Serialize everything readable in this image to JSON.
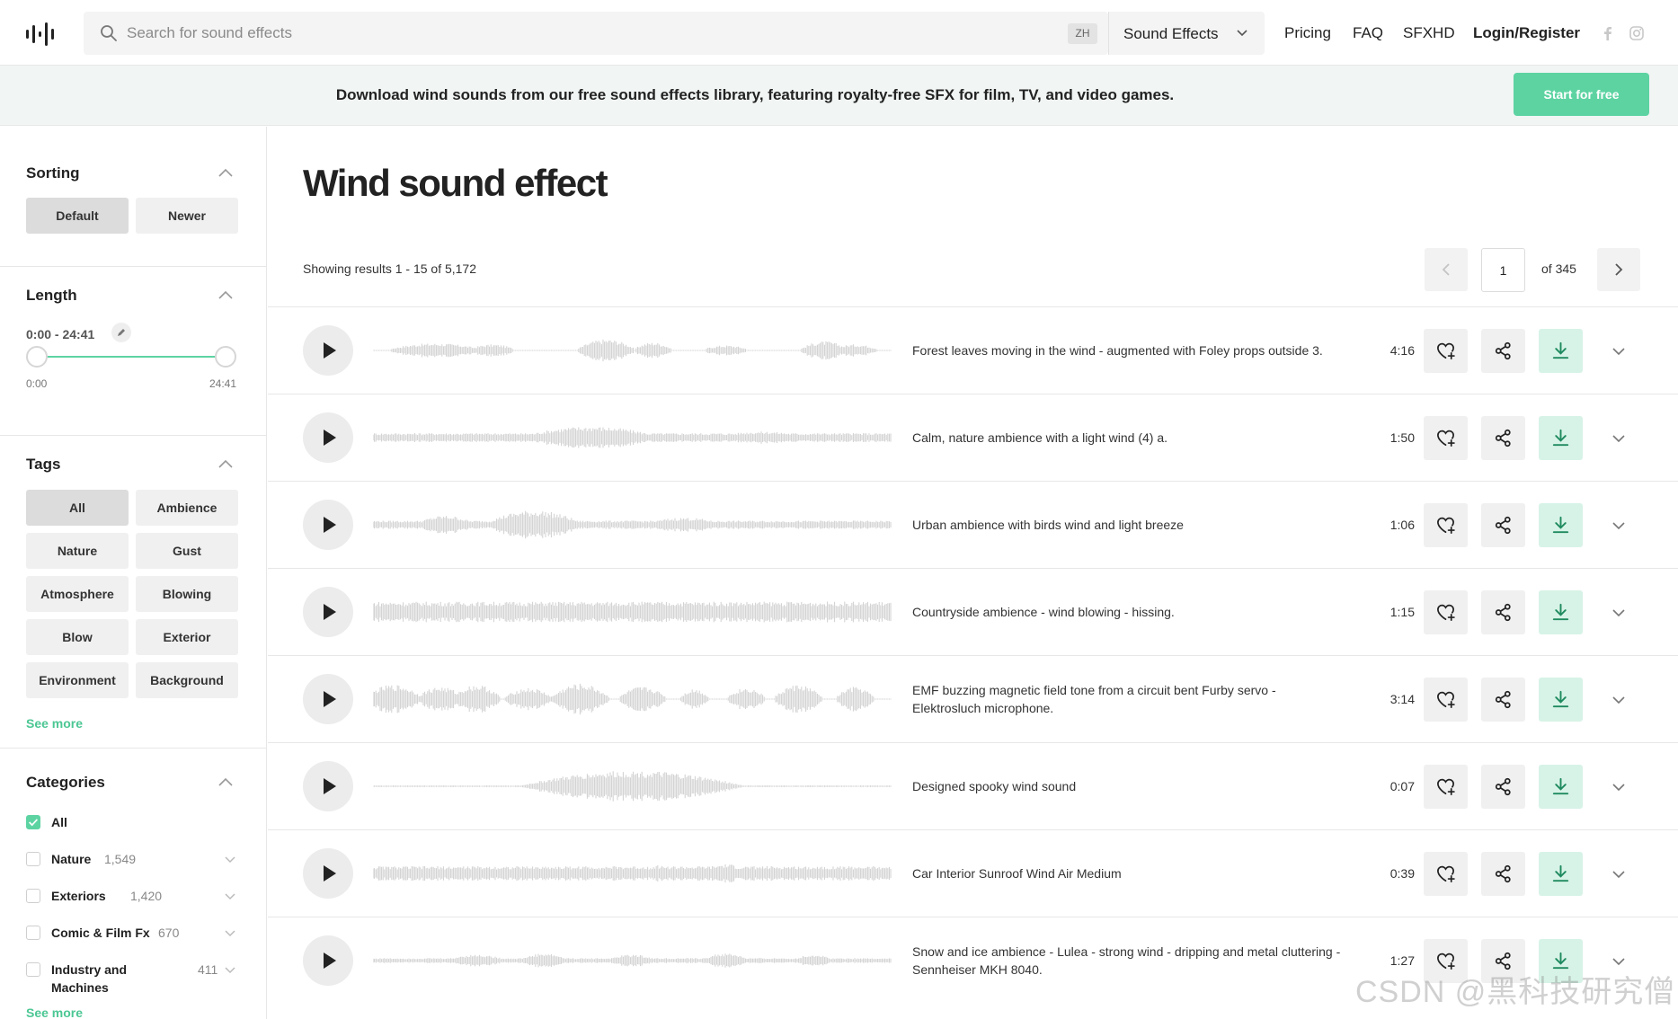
{
  "header": {
    "search": {
      "placeholder": "Search for sound effects",
      "lang_badge": "ZH"
    },
    "type_select": "Sound Effects",
    "nav": {
      "pricing": "Pricing",
      "faq": "FAQ",
      "sfxhd": "SFXHD",
      "login": "Login/Register"
    },
    "icons": [
      "logo-icon",
      "search-icon",
      "chevron-down-icon",
      "facebook-icon",
      "instagram-icon"
    ]
  },
  "banner": {
    "text": "Download wind sounds from our free sound effects library, featuring royalty-free SFX for film, TV, and video games.",
    "cta": "Start for free"
  },
  "sidebar": {
    "sorting": {
      "title": "Sorting",
      "options": [
        "Default",
        "Newer"
      ],
      "selected": "Default"
    },
    "length": {
      "title": "Length",
      "range_label": "0:00 - 24:41",
      "min_label": "0:00",
      "max_label": "24:41",
      "selected_min_fraction": 0.0,
      "selected_max_fraction": 1.0
    },
    "tags": {
      "title": "Tags",
      "items": [
        "All",
        "Ambience",
        "Nature",
        "Gust",
        "Atmosphere",
        "Blowing",
        "Blow",
        "Exterior",
        "Environment",
        "Background"
      ],
      "selected": "All",
      "see_more": "See more"
    },
    "categories": {
      "title": "Categories",
      "items": [
        {
          "name": "All",
          "count": "",
          "checked": true
        },
        {
          "name": "Nature",
          "count": "1,549",
          "checked": false
        },
        {
          "name": "Exteriors",
          "count": "1,420",
          "checked": false
        },
        {
          "name": "Comic & Film Fx",
          "count": "670",
          "checked": false
        },
        {
          "name": "Industry and Machines",
          "count": "411",
          "checked": false
        }
      ],
      "see_more": "See more"
    }
  },
  "main": {
    "title": "Wind sound effect",
    "results": "Showing results 1 - 15 of 5,172",
    "pagination": {
      "current": "1",
      "of_label": "of 345"
    },
    "rows": [
      {
        "title": "Forest leaves moving in the wind - augmented with Foley props outside 3.",
        "duration": "4:16"
      },
      {
        "title": "Calm, nature ambience with a light wind (4) a.",
        "duration": "1:50"
      },
      {
        "title": "Urban ambience with birds wind and light breeze",
        "duration": "1:06"
      },
      {
        "title": "Countryside ambience - wind blowing - hissing.",
        "duration": "1:15"
      },
      {
        "title": "EMF buzzing magnetic field tone from a circuit bent Furby servo - Elektrosluch microphone.",
        "duration": "3:14"
      },
      {
        "title": "Designed spooky wind sound",
        "duration": "0:07"
      },
      {
        "title": "Car Interior Sunroof Wind Air Medium",
        "duration": "0:39"
      },
      {
        "title": "Snow and ice ambience - Lulea - strong wind - dripping and metal cluttering - Sennheiser MKH 8040.",
        "duration": "1:27"
      }
    ],
    "row_action_icons": [
      "play-icon",
      "heart-plus-icon",
      "share-icon",
      "download-icon",
      "chevron-down-icon"
    ]
  },
  "watermark": "CSDN @黑科技研究僧",
  "colors": {
    "accent": "#5dd3a2",
    "link": "#4cc794",
    "waveform": "#cfcfcf",
    "banner_bg": "#f1f5f4"
  }
}
